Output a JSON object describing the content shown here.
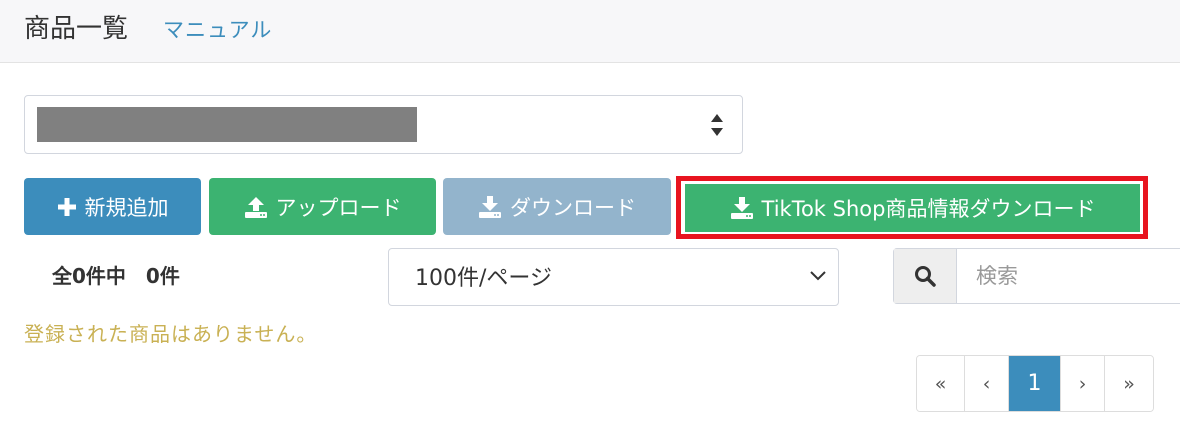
{
  "header": {
    "title": "商品一覧",
    "manual_link": "マニュアル"
  },
  "shop_select": {
    "value": "",
    "redacted": true
  },
  "toolbar": {
    "add_label": "新規追加",
    "upload_label": "アップロード",
    "download_label": "ダウンロード",
    "tiktok_download_label": "TikTok Shop商品情報ダウンロード"
  },
  "list": {
    "count_text": "全0件中　0件",
    "per_page": "100件/ページ",
    "search_placeholder": "検索",
    "empty_message": "登録された商品はありません。"
  },
  "pagination": {
    "first": "«",
    "prev": "‹",
    "current": "1",
    "next": "›",
    "last": "»"
  },
  "colors": {
    "primary": "#3c8dbc",
    "success": "#3cb371",
    "disabled": "#93b4cc",
    "highlight": "#e8141f",
    "empty_text": "#c9b154"
  }
}
